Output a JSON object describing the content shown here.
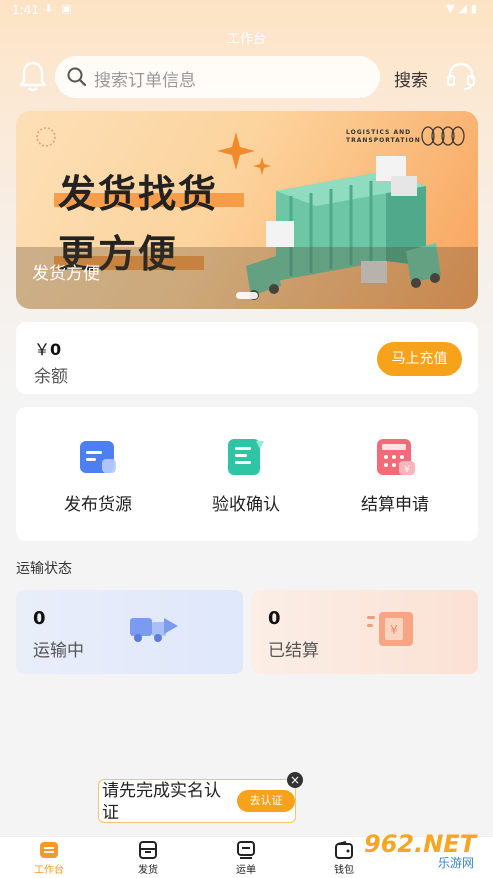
{
  "status_bar": {
    "time": "1:41"
  },
  "header": {
    "title": "工作台",
    "search_placeholder": "搜索订单信息",
    "search_button": "搜索"
  },
  "banner": {
    "headline_1": "发货找货",
    "headline_2": "更方便",
    "brand_text": "LOGISTICS AND TRANSPORTATION",
    "caption": "发货方便"
  },
  "balance": {
    "currency": "￥",
    "amount": "0",
    "label": "余额",
    "recharge_button": "马上充值"
  },
  "actions": [
    {
      "label": "发布货源",
      "icon": "publish-cargo-icon"
    },
    {
      "label": "验收确认",
      "icon": "acceptance-icon"
    },
    {
      "label": "结算申请",
      "icon": "settlement-icon"
    }
  ],
  "transport": {
    "section_title": "运输状态",
    "in_transit": {
      "count": "0",
      "label": "运输中"
    },
    "settled": {
      "count": "0",
      "label": "已结算"
    }
  },
  "verify_popup": {
    "message": "请先完成实名认证",
    "button": "去认证"
  },
  "tabs": [
    {
      "label": "工作台",
      "active": true
    },
    {
      "label": "发货",
      "active": false
    },
    {
      "label": "运单",
      "active": false
    },
    {
      "label": "钱包",
      "active": false
    }
  ],
  "watermark": {
    "main": "962.NET",
    "sub": "乐游网"
  },
  "colors": {
    "accent": "#f7a21b",
    "active_tab": "#f39a2a"
  }
}
